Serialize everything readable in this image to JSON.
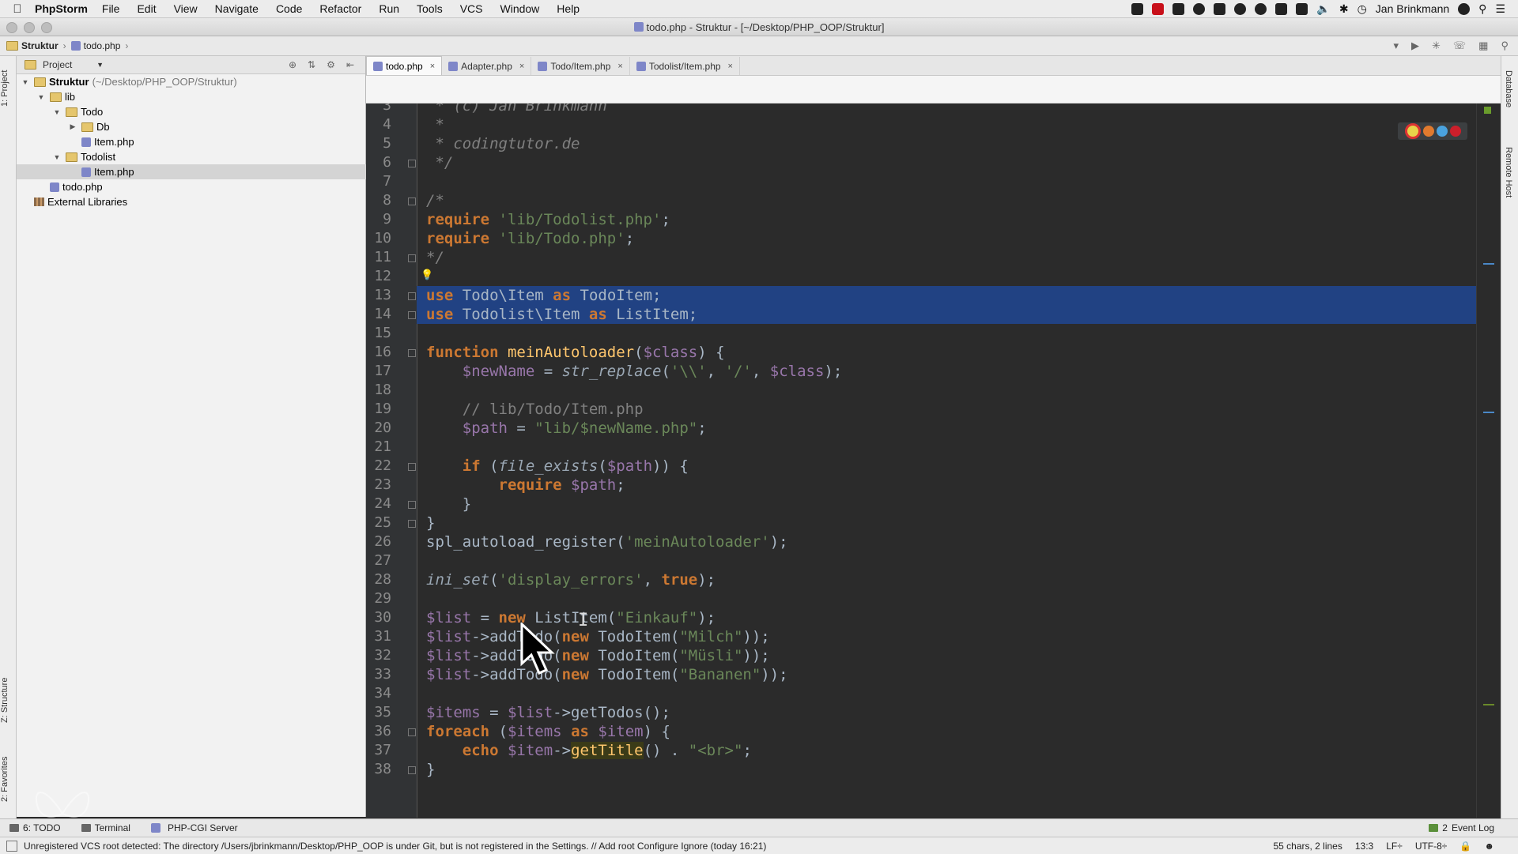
{
  "menubar": {
    "app": "PhpStorm",
    "items": [
      "File",
      "Edit",
      "View",
      "Navigate",
      "Code",
      "Refactor",
      "Run",
      "Tools",
      "VCS",
      "Window",
      "Help"
    ],
    "user": "Jan Brinkmann"
  },
  "window": {
    "title": "todo.php - Struktur - [~/Desktop/PHP_OOP/Struktur]"
  },
  "navbar": {
    "root": "Struktur",
    "file": "todo.php"
  },
  "project": {
    "dropdown": "Project",
    "tree": [
      {
        "label": "Struktur",
        "path": "(~/Desktop/PHP_OOP/Struktur)",
        "indent": 0,
        "type": "folder",
        "expanded": true
      },
      {
        "label": "lib",
        "indent": 1,
        "type": "folder",
        "expanded": true
      },
      {
        "label": "Todo",
        "indent": 2,
        "type": "folder",
        "expanded": true
      },
      {
        "label": "Db",
        "indent": 3,
        "type": "folder",
        "expanded": false
      },
      {
        "label": "Item.php",
        "indent": 3,
        "type": "php"
      },
      {
        "label": "Todolist",
        "indent": 2,
        "type": "folder",
        "expanded": true
      },
      {
        "label": "Item.php",
        "indent": 3,
        "type": "php",
        "selected": true
      },
      {
        "label": "todo.php",
        "indent": 1,
        "type": "php"
      },
      {
        "label": "External Libraries",
        "indent": 0,
        "type": "lib"
      }
    ]
  },
  "tabs": [
    {
      "label": "todo.php",
      "active": true
    },
    {
      "label": "Adapter.php"
    },
    {
      "label": "Todo/Item.php"
    },
    {
      "label": "Todolist/Item.php"
    }
  ],
  "side_tools": {
    "left_top": "1: Project",
    "left_mid": "Z: Structure",
    "left_bottom": "2: Favorites",
    "right_top": "Database",
    "right_mid": "Remote Host"
  },
  "code": {
    "lines": [
      {
        "n": "3",
        "text": " * (c) Jan Brinkmann"
      },
      {
        "n": "4",
        "text": " *"
      },
      {
        "n": "5",
        "text": " * codingtutor.de"
      },
      {
        "n": "6",
        "text": " */",
        "fold": true
      },
      {
        "n": "7",
        "text": ""
      },
      {
        "n": "8",
        "text": "/*",
        "fold": true
      },
      {
        "n": "9",
        "text": "require 'lib/Todolist.php';"
      },
      {
        "n": "10",
        "text": "require 'lib/Todo.php';"
      },
      {
        "n": "11",
        "text": "*/",
        "fold": true
      },
      {
        "n": "12",
        "text": ""
      },
      {
        "n": "13",
        "text": "use Todo\\Item as TodoItem;",
        "hl": true,
        "fold": true
      },
      {
        "n": "14",
        "text": "use Todolist\\Item as ListItem;",
        "hl": true,
        "fold": true
      },
      {
        "n": "15",
        "text": ""
      },
      {
        "n": "16",
        "text": "function meinAutoloader($class) {",
        "fold": true
      },
      {
        "n": "17",
        "text": "    $newName = str_replace('\\\\', '/', $class);"
      },
      {
        "n": "18",
        "text": ""
      },
      {
        "n": "19",
        "text": "    // lib/Todo/Item.php"
      },
      {
        "n": "20",
        "text": "    $path = \"lib/$newName.php\";"
      },
      {
        "n": "21",
        "text": ""
      },
      {
        "n": "22",
        "text": "    if (file_exists($path)) {",
        "fold": true
      },
      {
        "n": "23",
        "text": "        require $path;"
      },
      {
        "n": "24",
        "text": "    }",
        "fold": true
      },
      {
        "n": "25",
        "text": "}",
        "fold": true
      },
      {
        "n": "26",
        "text": "spl_autoload_register('meinAutoloader');"
      },
      {
        "n": "27",
        "text": ""
      },
      {
        "n": "28",
        "text": "ini_set('display_errors', true);"
      },
      {
        "n": "29",
        "text": ""
      },
      {
        "n": "30",
        "text": "$list = new ListItem(\"Einkauf\");"
      },
      {
        "n": "31",
        "text": "$list->addTodo(new TodoItem(\"Milch\"));"
      },
      {
        "n": "32",
        "text": "$list->addTodo(new TodoItem(\"Müsli\"));"
      },
      {
        "n": "33",
        "text": "$list->addTodo(new TodoItem(\"Bananen\"));"
      },
      {
        "n": "34",
        "text": ""
      },
      {
        "n": "35",
        "text": "$items = $list->getTodos();"
      },
      {
        "n": "36",
        "text": "foreach ($items as $item) {",
        "fold": true
      },
      {
        "n": "37",
        "text": "    echo $item->getTitle() . \"<br>\";"
      },
      {
        "n": "38",
        "text": "}",
        "fold": true
      }
    ]
  },
  "bottom_tools": {
    "todo": "6: TODO",
    "terminal": "Terminal",
    "server": "PHP-CGI Server",
    "event_log": "Event Log",
    "event_count": "2"
  },
  "status": {
    "message": "Unregistered VCS root detected: The directory /Users/jbrinkmann/Desktop/PHP_OOP is under Git, but is not registered in the Settings. // Add root  Configure  Ignore (today 16:21)",
    "selection": "55 chars, 2 lines",
    "position": "13:3",
    "line_sep": "LF÷",
    "encoding": "UTF-8÷"
  },
  "colors": {
    "keyword": "#cc7832",
    "string": "#6a8759",
    "variable": "#9876aa",
    "function": "#ffc66d",
    "comment": "#629755",
    "italic_comment": "#808080",
    "selection": "#214283",
    "text": "#a9b7c6"
  }
}
